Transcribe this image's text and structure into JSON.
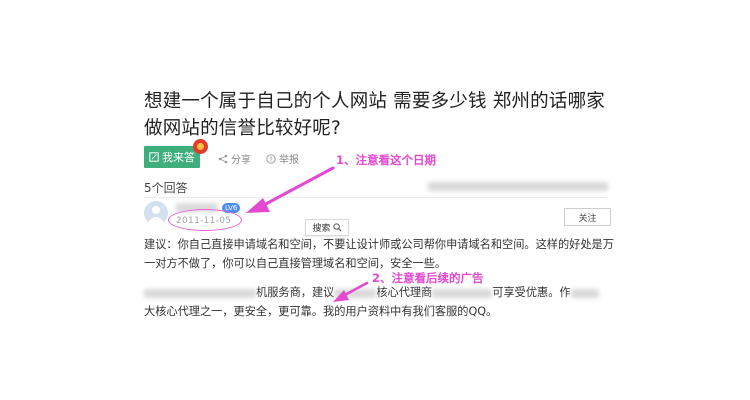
{
  "question": {
    "title": "想建一个属于自己的个人网站 需要多少钱 郑州的话哪家做网站的信誉比较好呢?"
  },
  "actions": {
    "answer_label": "我来答",
    "share_label": "分享",
    "report_label": "举报"
  },
  "answers": {
    "count_label": "5个回答"
  },
  "answer": {
    "vip_label": "LV6",
    "date": "2011-11-05",
    "follow_label": "关注",
    "search_tip": "搜索",
    "paragraph1": "建议：你自己直接申请域名和空间，不要让设计师或公司帮你申请域名和空间。这样的好处是万一对方不做了，你可以自己直接管理域名和空间，安全一些。",
    "paragraph2_a": "机服务商，建议",
    "paragraph2_b": "核心代理商",
    "paragraph2_c": "可享受优惠。作",
    "paragraph2_d": "大核心代理之一，更安全，更可靠。我的用户资料中有我们客服的QQ。"
  },
  "annotations": {
    "note1": "1、注意看这个日期",
    "note2": "2、注意看后续的广告"
  },
  "colors": {
    "accent_green": "#3eaf7c",
    "annotation_magenta": "#e34ad1",
    "redpacket": "#e53b2c"
  }
}
